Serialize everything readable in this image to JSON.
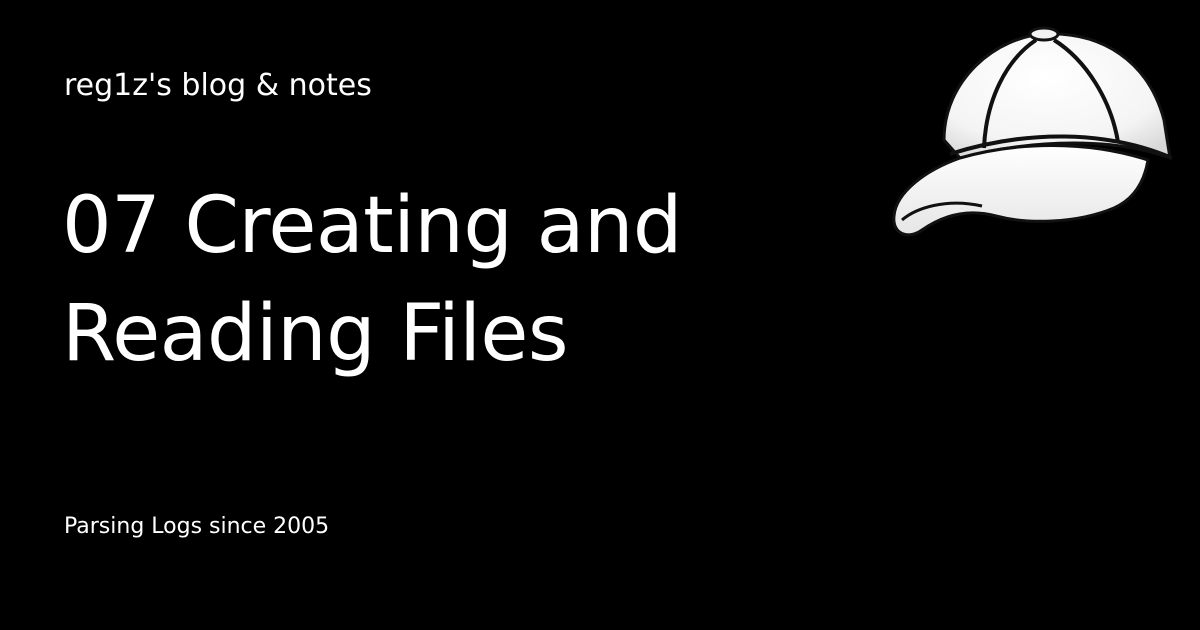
{
  "site": {
    "name": "reg1z's blog & notes",
    "tagline": "Parsing Logs since 2005"
  },
  "post": {
    "title": "07 Creating and Reading Files"
  },
  "logo": {
    "icon": "baseball-cap-icon"
  },
  "colors": {
    "background": "#000000",
    "text": "#ffffff"
  }
}
